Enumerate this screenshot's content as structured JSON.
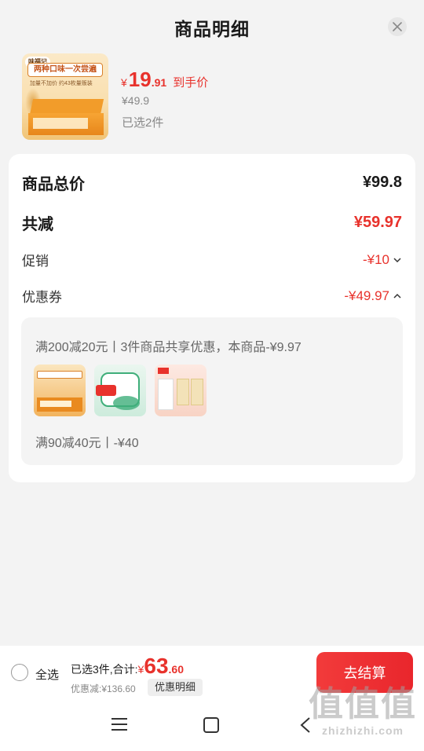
{
  "header": {
    "title": "商品明细"
  },
  "product": {
    "image_brand": "味福记",
    "image_banner": "两种口味一次尝遍",
    "image_sub": "加量不加价 约43枚量贩装",
    "price_symbol": "¥",
    "price_int": "19",
    "price_dec": ".91",
    "price_tag": "到手价",
    "original_price": "¥49.9",
    "selected_count": "已选2件"
  },
  "summary": {
    "total_label": "商品总价",
    "total_value": "¥99.8",
    "reduce_label": "共减",
    "reduce_value": "¥59.97",
    "promo_label": "促销",
    "promo_value": "-¥10",
    "coupon_label": "优惠券",
    "coupon_value": "-¥49.97"
  },
  "coupon_detail": {
    "rule1": "满200减20元丨3件商品共享优惠，本商品-¥9.97",
    "rule2": "满90减40元丨-¥40"
  },
  "bottom_bar": {
    "select_all": "全选",
    "selected_total_text": "已选3件,合计:",
    "total_symbol": "¥",
    "total_int": "63",
    "total_dec": ".60",
    "discount_text": "优惠减:¥136.60",
    "detail_chip": "优惠明细",
    "checkout_label": "去结算"
  },
  "watermark": {
    "big": "值值值",
    "small": "zhizhizhi.com"
  },
  "colors": {
    "accent_red": "#e8322c",
    "background": "#f3f3f3"
  },
  "icons": {
    "close": "close-icon",
    "promo_chevron": "chevron-down-icon",
    "coupon_chevron": "chevron-up-icon",
    "nav_menu": "menu-icon",
    "nav_home": "home-icon",
    "nav_back": "back-icon"
  }
}
